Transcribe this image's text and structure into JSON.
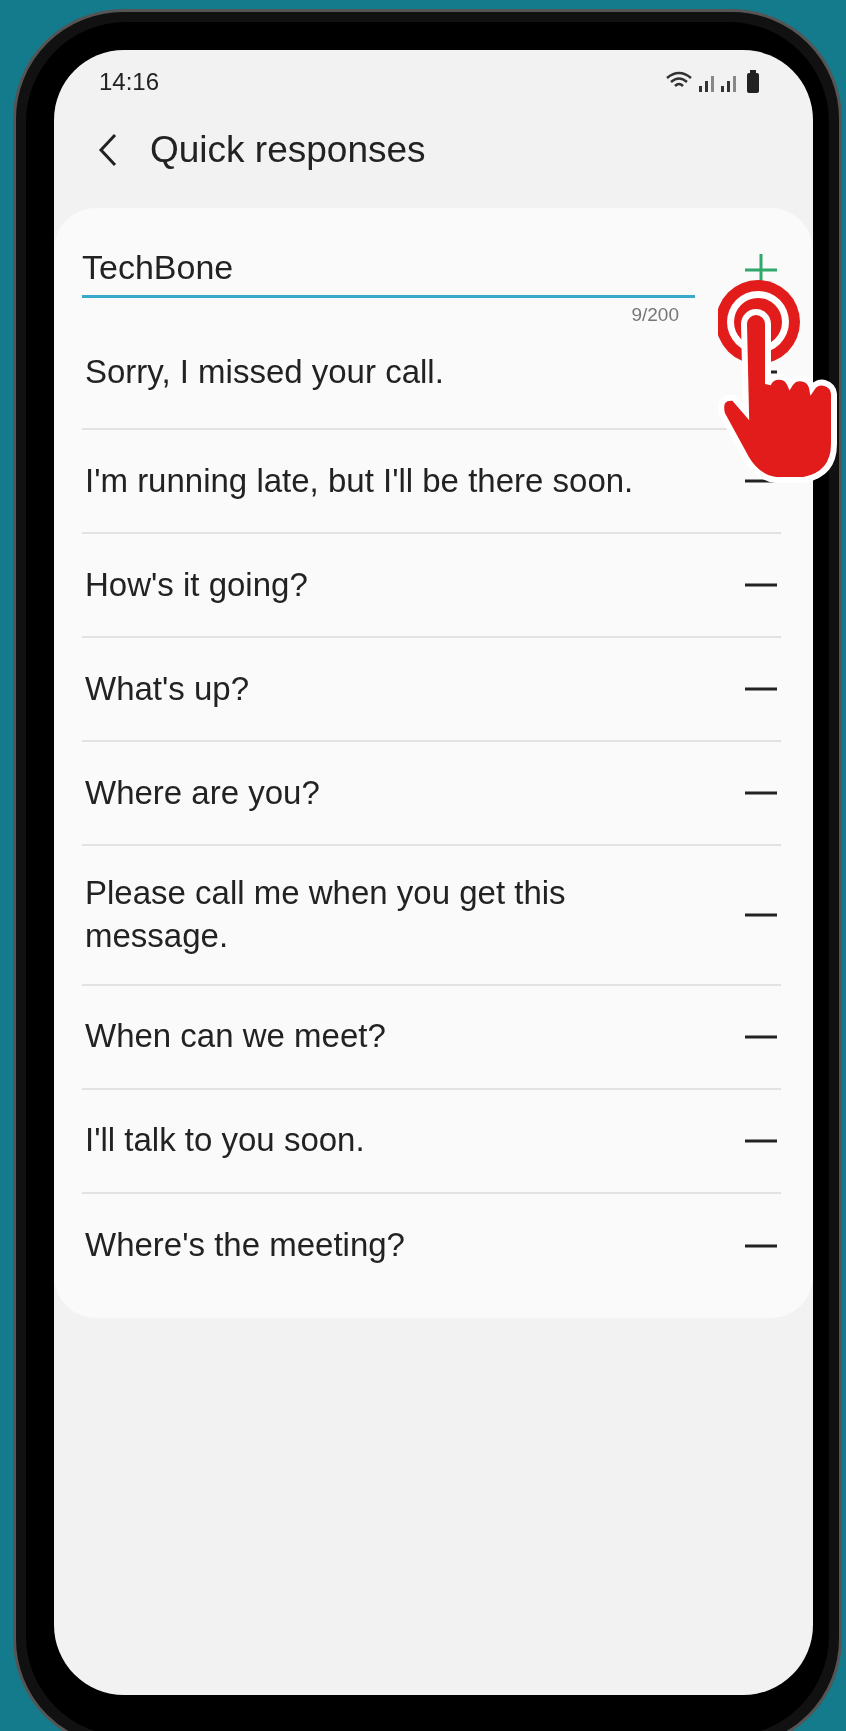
{
  "status_bar": {
    "time": "14:16"
  },
  "header": {
    "title": "Quick responses"
  },
  "new_response": {
    "value": "TechBone",
    "counter": "9/200"
  },
  "responses": [
    {
      "text": "Sorry, I missed your call."
    },
    {
      "text": "I'm running late, but I'll be there soon."
    },
    {
      "text": "How's it going?"
    },
    {
      "text": "What's up?"
    },
    {
      "text": "Where are you?"
    },
    {
      "text": "Please call me when you get this message."
    },
    {
      "text": "When can we meet?"
    },
    {
      "text": "I'll talk to you soon."
    },
    {
      "text": "Where's the meeting?"
    }
  ]
}
